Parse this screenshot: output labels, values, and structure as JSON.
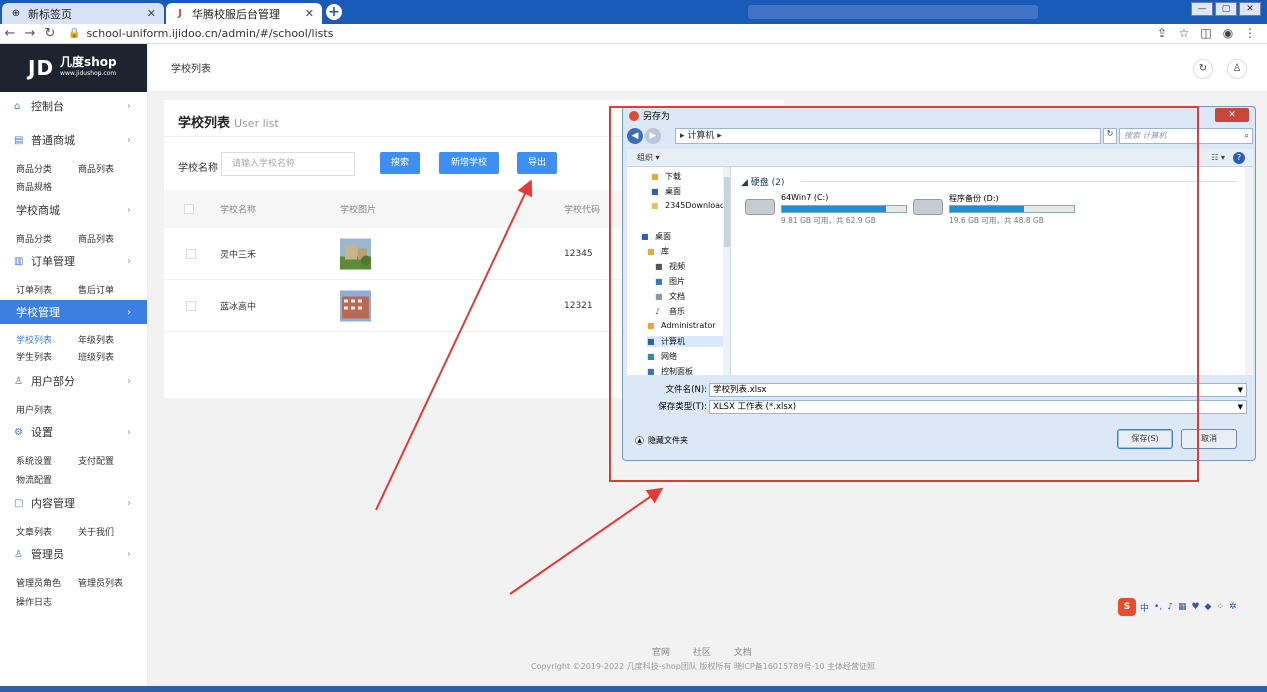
{
  "browser": {
    "tabs": [
      {
        "label": "新标签页",
        "active": false
      },
      {
        "label": "华腾校服后台管理",
        "active": true
      }
    ],
    "url": "school-uniform.ijidoo.cn/admin/#/school/lists"
  },
  "logo": {
    "mark": "JD",
    "brand": "几度shop",
    "domain": "www.jidushop.com"
  },
  "sidebar": {
    "groups": [
      {
        "label": "控制台",
        "icon": "dashboard-icon",
        "top": 0
      },
      {
        "label": "普通商城",
        "icon": "shop-icon"
      },
      {
        "label": "学校商城"
      },
      {
        "label": "订单管理",
        "icon": "order-icon"
      },
      {
        "label": "学校管理",
        "active": true
      },
      {
        "label": "用户部分",
        "icon": "user-icon"
      },
      {
        "label": "设置",
        "icon": "gear-icon"
      },
      {
        "label": "内容管理",
        "icon": "content-icon"
      },
      {
        "label": "管理员",
        "icon": "admin-icon"
      }
    ],
    "rows": {
      "shop1": [
        "商品分类",
        "商品列表"
      ],
      "shop2": [
        "商品规格"
      ],
      "school_shop": [
        "商品分类",
        "商品列表"
      ],
      "order": [
        "订单列表",
        "售后订单"
      ],
      "school1": [
        "学校列表",
        "年级列表"
      ],
      "school2": [
        "学生列表",
        "班级列表"
      ],
      "user": [
        "用户列表"
      ],
      "settings1": [
        "系统设置",
        "支付配置"
      ],
      "settings2": [
        "物流配置"
      ],
      "content": [
        "文章列表",
        "关于我们"
      ],
      "admin1": [
        "管理员角色",
        "管理员列表"
      ],
      "admin2": [
        "操作日志"
      ]
    }
  },
  "topbar": {
    "title": "学校列表"
  },
  "card": {
    "title": "学校列表",
    "subtitle": "User list",
    "search_label": "学校名称",
    "search_placeholder": "请输入学校名称",
    "buttons": {
      "search": "搜索",
      "add": "新增学校",
      "export": "导出"
    },
    "columns": [
      "学校名称",
      "学校图片",
      "学校代码"
    ],
    "rows": [
      {
        "name": "灵中三禾",
        "code": "12345"
      },
      {
        "name": "蓝冰高中",
        "code": "12321"
      }
    ]
  },
  "footer": {
    "links": [
      "官网",
      "社区",
      "文档"
    ],
    "copyright": "Copyright ©2019-2022 几度科技-shop团队 版权所有 晓ICP备16015789号-10 主体经营证照"
  },
  "dialog": {
    "title": "另存为",
    "breadcrumb": "▸ 计算机 ▸",
    "search_placeholder": "搜索 计算机",
    "organize": "组织 ▾",
    "tree": [
      "下载",
      "桌面",
      "2345Downloads",
      "桌面",
      "库",
      "视频",
      "图片",
      "文档",
      "音乐",
      "Administrator",
      "计算机",
      "网络",
      "控制面板"
    ],
    "disk_heading": "◢ 硬盘 (2)",
    "drives": [
      {
        "name": "64Win7 (C:)",
        "free": "9.81 GB 可用，共 62.9 GB",
        "used": 0.84
      },
      {
        "name": "程序备份 (D:)",
        "free": "19.6 GB 可用，共 48.8 GB",
        "used": 0.6
      }
    ],
    "filename_label": "文件名(N):",
    "filename": "学校列表.xlsx",
    "filetype_label": "保存类型(T):",
    "filetype": "XLSX 工作表 (*.xlsx)",
    "hide_folders": "隐藏文件夹",
    "save": "保存(S)",
    "cancel": "取消"
  },
  "ime": {
    "label": "中"
  },
  "colors": {
    "primary": "#3d8ff2",
    "sidebar_active": "#3d7fe0",
    "highlight": "#e53935"
  }
}
